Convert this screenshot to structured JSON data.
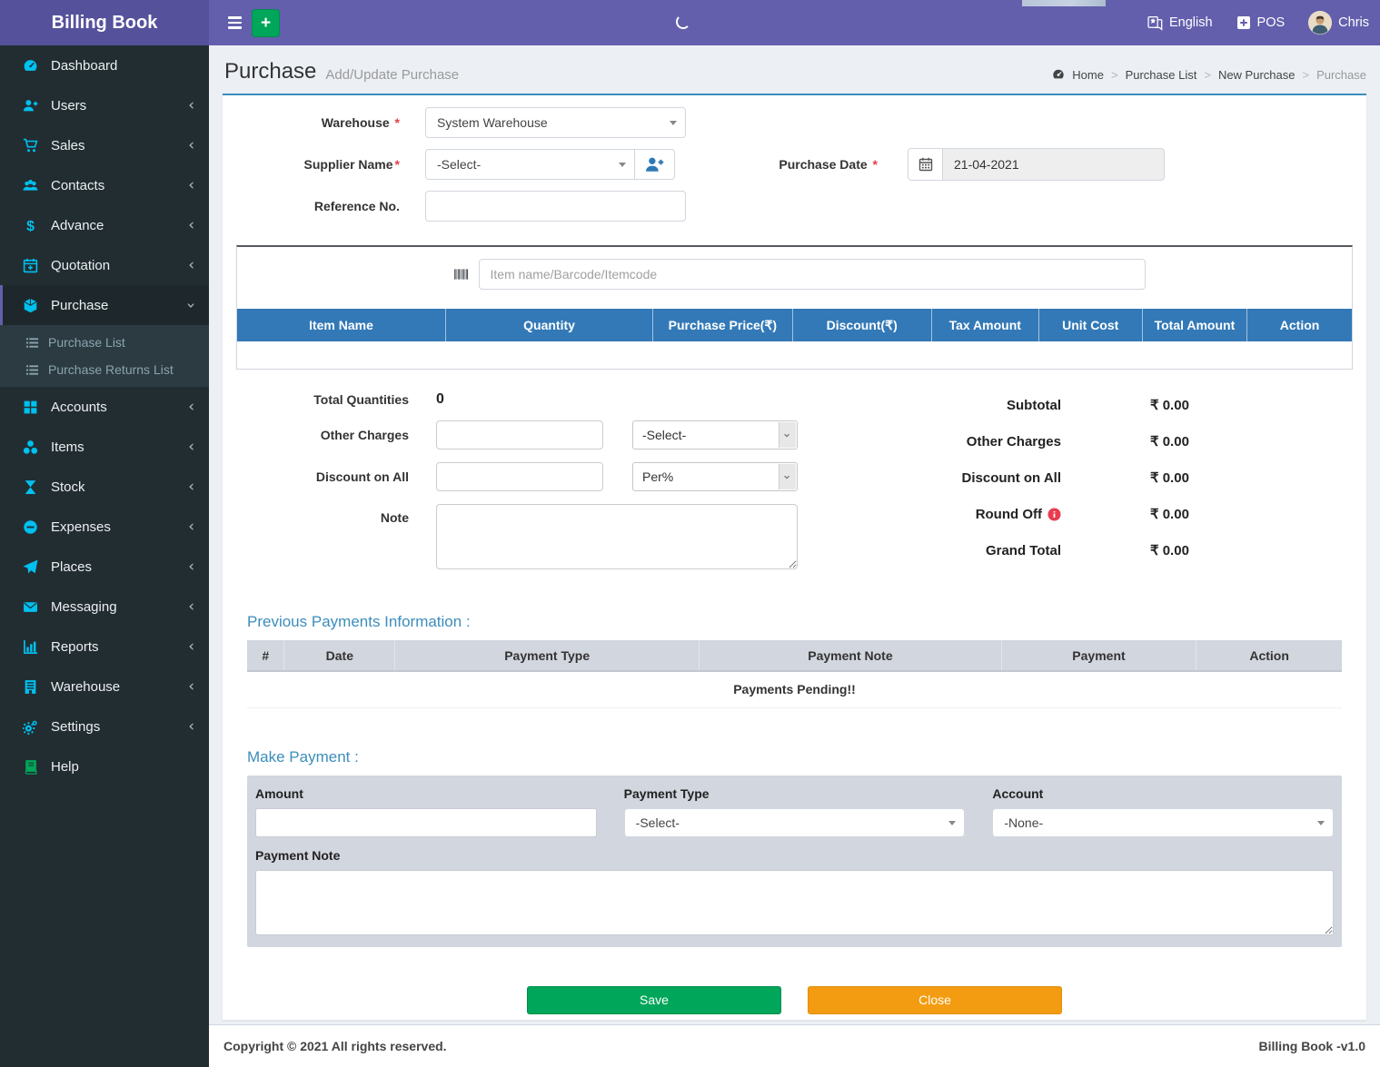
{
  "header": {
    "brand": "Billing Book",
    "language_label": "English",
    "pos_label": "POS",
    "user_name": "Chris"
  },
  "sidebar": {
    "items": [
      {
        "label": "Dashboard",
        "icon": "dashboard",
        "chevron": false,
        "active": false
      },
      {
        "label": "Users",
        "icon": "user-plus",
        "chevron": true,
        "active": false
      },
      {
        "label": "Sales",
        "icon": "cart",
        "chevron": true,
        "active": false
      },
      {
        "label": "Contacts",
        "icon": "users",
        "chevron": true,
        "active": false
      },
      {
        "label": "Advance",
        "icon": "dollar",
        "chevron": true,
        "active": false
      },
      {
        "label": "Quotation",
        "icon": "calendar-plus",
        "chevron": true,
        "active": false
      },
      {
        "label": "Purchase",
        "icon": "cube",
        "chevron": true,
        "active": true
      },
      {
        "label": "Accounts",
        "icon": "grid",
        "chevron": true,
        "active": false
      },
      {
        "label": "Items",
        "icon": "cubes",
        "chevron": true,
        "active": false
      },
      {
        "label": "Stock",
        "icon": "hourglass",
        "chevron": true,
        "active": false
      },
      {
        "label": "Expenses",
        "icon": "minus-circle",
        "chevron": true,
        "active": false
      },
      {
        "label": "Places",
        "icon": "paper-plane",
        "chevron": true,
        "active": false
      },
      {
        "label": "Messaging",
        "icon": "envelope",
        "chevron": true,
        "active": false
      },
      {
        "label": "Reports",
        "icon": "bar-chart",
        "chevron": true,
        "active": false
      },
      {
        "label": "Warehouse",
        "icon": "building",
        "chevron": true,
        "active": false
      },
      {
        "label": "Settings",
        "icon": "gears",
        "chevron": true,
        "active": false
      },
      {
        "label": "Help",
        "icon": "book",
        "chevron": false,
        "active": false,
        "icon_color": "green"
      }
    ],
    "purchase_children": [
      {
        "label": "Purchase List",
        "icon": "list"
      },
      {
        "label": "Purchase Returns List",
        "icon": "list"
      }
    ]
  },
  "page": {
    "title": "Purchase",
    "subtitle": "Add/Update Purchase",
    "breadcrumb": [
      "Home",
      "Purchase List",
      "New Purchase",
      "Purchase"
    ]
  },
  "form": {
    "warehouse_label": "Warehouse",
    "warehouse_value": "System Warehouse",
    "supplier_label": "Supplier Name",
    "supplier_value": "-Select-",
    "reference_label": "Reference No.",
    "reference_value": "",
    "purchase_date_label": "Purchase Date",
    "purchase_date_value": "21-04-2021",
    "item_search_placeholder": "Item name/Barcode/Itemcode"
  },
  "items_table": {
    "columns": [
      "Item Name",
      "Quantity",
      "Purchase Price(₹)",
      "Discount(₹)",
      "Tax Amount",
      "Unit Cost",
      "Total Amount",
      "Action"
    ]
  },
  "totals": {
    "total_quantities_label": "Total Quantities",
    "total_quantities_value": "0",
    "other_charges_label": "Other Charges",
    "other_charges_value": "",
    "other_charges_select": "-Select-",
    "discount_label": "Discount on All",
    "discount_value": "",
    "discount_select": "Per%",
    "note_label": "Note",
    "note_value": ""
  },
  "summary": {
    "rows": [
      {
        "label": "Subtotal",
        "value": "₹ 0.00",
        "info": false
      },
      {
        "label": "Other Charges",
        "value": "₹ 0.00",
        "info": false
      },
      {
        "label": "Discount on All",
        "value": "₹ 0.00",
        "info": false
      },
      {
        "label": "Round Off",
        "value": "₹ 0.00",
        "info": true
      },
      {
        "label": "Grand Total",
        "value": "₹ 0.00",
        "info": false
      }
    ]
  },
  "previous_payments": {
    "heading": "Previous Payments Information :",
    "columns": [
      "#",
      "Date",
      "Payment Type",
      "Payment Note",
      "Payment",
      "Action"
    ],
    "empty_text": "Payments Pending!!"
  },
  "make_payment": {
    "heading": "Make Payment :",
    "amount_label": "Amount",
    "amount_value": "",
    "payment_type_label": "Payment Type",
    "payment_type_value": "-Select-",
    "account_label": "Account",
    "account_value": "-None-",
    "payment_note_label": "Payment Note",
    "payment_note_value": ""
  },
  "actions": {
    "save": "Save",
    "close": "Close"
  },
  "footer": {
    "left": "Copyright © 2021 All rights reserved.",
    "right": "Billing Book -v1.0"
  },
  "colors": {
    "topbar": "#635fad",
    "logo_bg": "#55519b",
    "sidebar_bg": "#222d32",
    "sidebar_icon": "#00c0ef",
    "accent_blue": "#3c8dbc",
    "table_header_blue": "#3379b7",
    "green": "#00a65a",
    "orange": "#f39c12",
    "required_red": "#e73d4a",
    "info_pink": "#e73d4f",
    "content_bg": "#ecf0f5",
    "grey_panel": "#d2d6de"
  }
}
